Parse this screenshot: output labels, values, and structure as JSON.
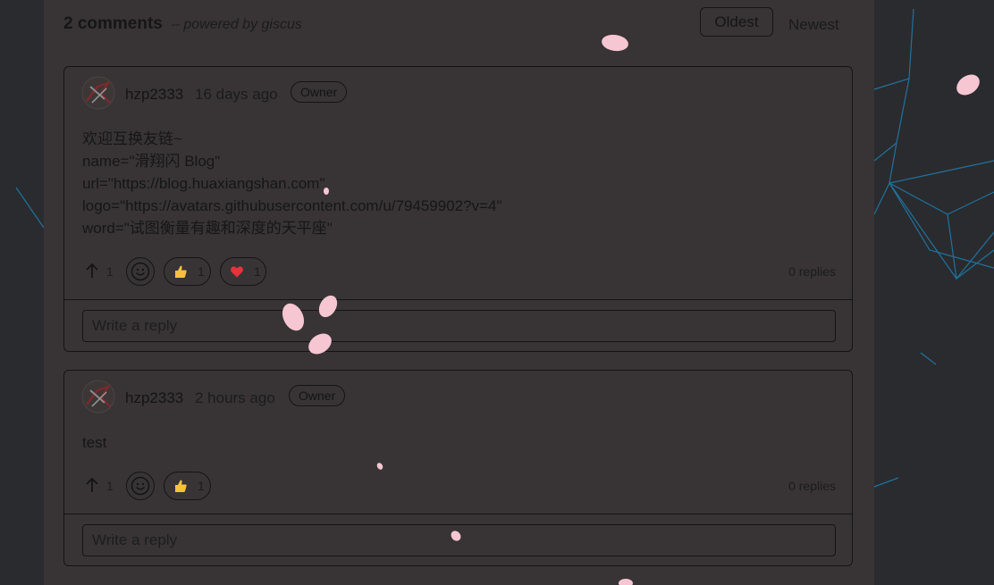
{
  "header": {
    "count_label": "2 comments",
    "powered_label": "– powered by giscus",
    "sort_oldest": "Oldest",
    "sort_newest": "Newest"
  },
  "comments": [
    {
      "author": "hzp2333",
      "time": "16 days ago",
      "badge": "Owner",
      "body": "欢迎互换友链~\nname=\"滑翔闪 Blog\"\nurl=\"https://blog.huaxiangshan.com\"\nlogo=\"https://avatars.githubusercontent.com/u/79459902?v=4\"\nword=\"试图衡量有趣和深度的天平座\"",
      "upvotes": "1",
      "reactions": [
        {
          "icon": "thumbs-up-icon",
          "count": "1"
        },
        {
          "icon": "heart-icon",
          "count": "1"
        }
      ],
      "replies": "0 replies",
      "reply_placeholder": "Write a reply"
    },
    {
      "author": "hzp2333",
      "time": "2 hours ago",
      "badge": "Owner",
      "body": "test",
      "upvotes": "1",
      "reactions": [
        {
          "icon": "thumbs-up-icon",
          "count": "1"
        }
      ],
      "replies": "0 replies",
      "reply_placeholder": "Write a reply"
    }
  ],
  "colors": {
    "page_background": "#2a2b2f",
    "panel_background": "#383435",
    "network_lines": "#1e7fb0",
    "petal": "#f7c6d3",
    "heart": "#e8323c",
    "thumb": "#f5c23c"
  }
}
